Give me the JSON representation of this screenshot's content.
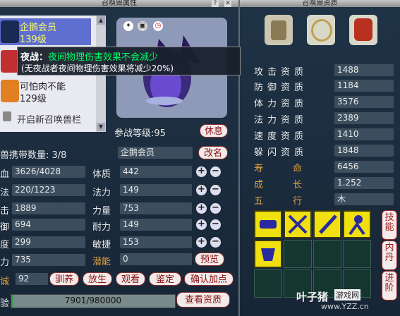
{
  "left_title": "召唤兽属性",
  "right_title": "召唤兽资质",
  "pets": [
    {
      "name": "企鹅会员",
      "level": "139级",
      "selected": true
    },
    {
      "name": "",
      "level": "",
      "selected": false
    },
    {
      "name": "可怕肉不能",
      "level": "129级",
      "selected": false
    }
  ],
  "add_slot": "开启新召唤兽栏",
  "tooltip": {
    "prefix": "夜战：",
    "effect": "夜间物理伤害效果不会减少",
    "note": "(无夜战者夜间物理伤害效果将减少20%)"
  },
  "battle_level": "参战等级:95",
  "rest_button": "休息",
  "carry": "兽携带数量: 3/8",
  "name_value": "企鹅会员",
  "rename_button": "改名",
  "stats_left": [
    {
      "label": "血",
      "value": "3626/4028"
    },
    {
      "label": "法",
      "value": "220/1223"
    },
    {
      "label": "击",
      "value": "1889"
    },
    {
      "label": "御",
      "value": "694"
    },
    {
      "label": "度",
      "value": "299"
    },
    {
      "label": "力",
      "value": "735"
    }
  ],
  "loyalty_label": "诚",
  "loyalty_value": "92",
  "attrs": [
    {
      "label": "体质",
      "value": "442"
    },
    {
      "label": "法力",
      "value": "149"
    },
    {
      "label": "力量",
      "value": "753"
    },
    {
      "label": "耐力",
      "value": "149"
    },
    {
      "label": "敏捷",
      "value": "153"
    }
  ],
  "potential_label": "潜能",
  "potential_value": "0",
  "preview_button": "预览",
  "actions": [
    "驯养",
    "放生",
    "观看",
    "鉴定",
    "确认加点"
  ],
  "exp_label": "验",
  "exp_value": "7901/980000",
  "exp_progress": 0.008,
  "view_button": "查看资质",
  "aptitudes": [
    {
      "label": "攻击资质",
      "value": "1488"
    },
    {
      "label": "防御资质",
      "value": "1184"
    },
    {
      "label": "体力资质",
      "value": "3576"
    },
    {
      "label": "法力资质",
      "value": "2389"
    },
    {
      "label": "速度资质",
      "value": "1410"
    },
    {
      "label": "躲闪资质",
      "value": "1848"
    }
  ],
  "lifespan_label": "寿命",
  "lifespan_value": "6456",
  "growth_label": "成长",
  "growth_value": "1.252",
  "element_label": "五行",
  "element_value": "木",
  "side_buttons": [
    "技能",
    "内丹",
    "进阶"
  ],
  "watermark_brand": "叶子猪",
  "watermark_tag": "游戏网",
  "watermark_url": "www.YZZ.cn",
  "colors": {
    "accent_yellow": "#f0e010",
    "label_orange": "#e0a040",
    "selected": "#5f6fd0"
  }
}
